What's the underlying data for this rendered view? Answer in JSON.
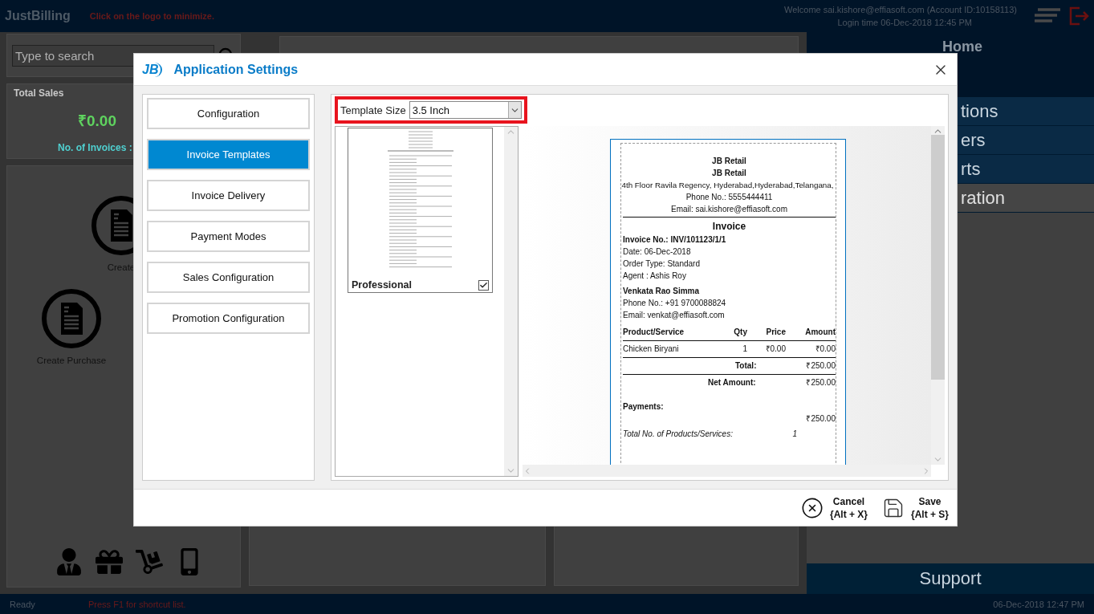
{
  "top_bar": {
    "logo": "JustBilling",
    "hint": "Click on the logo to minimize.",
    "welcome": "Welcome sai.kishore@effiasoft.com (Account ID:10158113)",
    "login_time": "Login time  06-Dec-2018 12:45 PM"
  },
  "left_panel": {
    "search": {
      "placeholder": "Type to search"
    },
    "sales": {
      "title": "Total Sales",
      "amount": "₹0.00",
      "invoices_label": "No. of Invoices :"
    },
    "actions": [
      {
        "label": "Create"
      },
      {
        "label": "Create Purchase"
      }
    ]
  },
  "right_panel": {
    "title": "Home",
    "nav": [
      {
        "label": "tions",
        "selected": false
      },
      {
        "label": "ers",
        "selected": false
      },
      {
        "label": "rts",
        "selected": false
      },
      {
        "label": "ration",
        "selected": true
      }
    ],
    "support": "Support"
  },
  "status_bar": {
    "status": "Ready",
    "hint": "Press F1 for shortcut list.",
    "datetime": "06-Dec-2018 12:47 PM"
  },
  "dialog": {
    "logo": "JB",
    "title": "Application Settings",
    "menu": [
      {
        "label": "Configuration",
        "selected": false
      },
      {
        "label": "Invoice Templates",
        "selected": true
      },
      {
        "label": "Invoice Delivery",
        "selected": false
      },
      {
        "label": "Payment Modes",
        "selected": false
      },
      {
        "label": "Sales Configuration",
        "selected": false
      },
      {
        "label": "Promotion Configuration",
        "selected": false
      }
    ],
    "template_size": {
      "label": "Template Size",
      "value": "3.5 Inch"
    },
    "templates": [
      {
        "name": "Professional",
        "checked": true
      }
    ],
    "receipt": {
      "header": [
        "JB Retail",
        "JB Retail",
        "4th Floor Ravila Regency, Hyderabad,Hyderabad,Telangana,",
        "Phone No.: 5555444411",
        "Email: sai.kishore@effiasoft.com"
      ],
      "title": "Invoice",
      "invoice_no": "Invoice No.: INV/101123/1/1",
      "details": [
        "Date: 06-Dec-2018",
        "Order Type: Standard",
        "Agent : Ashis Roy"
      ],
      "customer_name": "Venkata Rao Simma",
      "customer_details": [
        "Phone No.: +91 9700088824",
        "Email: venkat@effiasoft.com"
      ],
      "columns": [
        "Product/Service",
        "Qty",
        "Price",
        "Amount"
      ],
      "rows": [
        [
          "Chicken Biryani",
          "1",
          "₹0.00",
          "₹0.00"
        ]
      ],
      "total_label": "Total:",
      "total": "₹250.00",
      "net_label": "Net Amount:",
      "net": "₹250.00",
      "payments_label": "Payments:",
      "payment_amount": "₹250.00",
      "count_label": "Total No. of Products/Services:",
      "count": "1"
    },
    "buttons": [
      {
        "kind": "cancel",
        "label": "Cancel",
        "shortcut": "{Alt + X}"
      },
      {
        "kind": "save",
        "label": "Save",
        "shortcut": "{Alt + S}"
      }
    ]
  }
}
